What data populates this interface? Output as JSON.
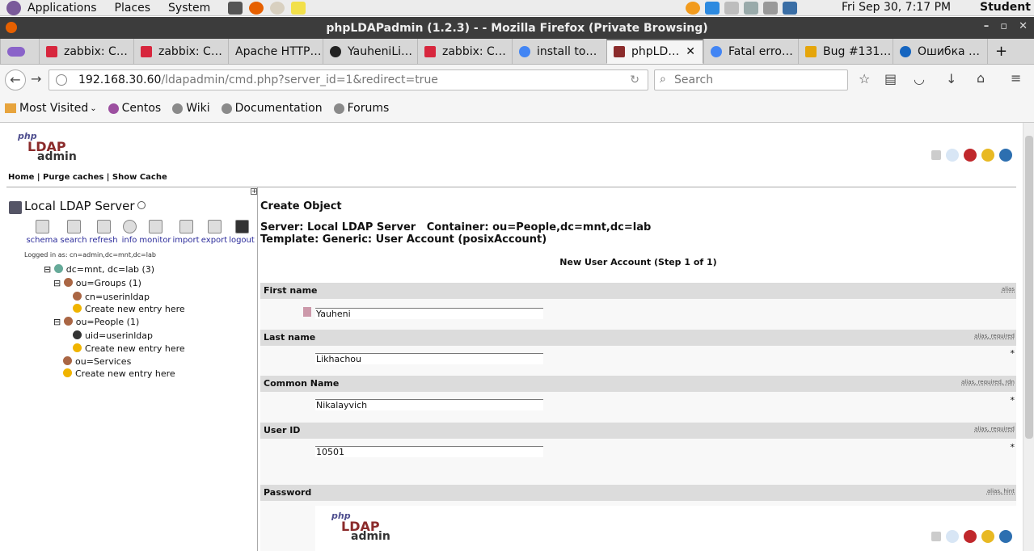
{
  "topbar": {
    "applications": "Applications",
    "places": "Places",
    "system": "System",
    "clock": "Fri Sep 30,  7:17 PM",
    "user": "Student"
  },
  "window": {
    "title": "phpLDAPadmin (1.2.3) - - Mozilla Firefox (Private Browsing)",
    "minimize": "–",
    "maximize": "▫",
    "close": "✕"
  },
  "tabs": [
    {
      "label": "zabbix: C…",
      "color": "#d7263d"
    },
    {
      "label": "zabbix: C…",
      "color": "#d7263d"
    },
    {
      "label": "Apache HTTP…",
      "color": "#d7d7d7"
    },
    {
      "label": "YauheniLi…",
      "color": "#222222"
    },
    {
      "label": "zabbix: C…",
      "color": "#d7263d"
    },
    {
      "label": "install to…",
      "color": "#4285f4"
    },
    {
      "label": "phpLD…",
      "color": "#8b2b2b"
    },
    {
      "label": "Fatal erro…",
      "color": "#4285f4"
    },
    {
      "label": "Bug #131…",
      "color": "#e5a50a"
    },
    {
      "label": "Ошибка …",
      "color": "#1565c0"
    }
  ],
  "active_tab_close": "✕",
  "new_tab": "+",
  "nav": {
    "url_host": "192.168.30.60",
    "url_path": "/ldapadmin/cmd.php?server_id=1&redirect=true",
    "search_placeholder": "Search"
  },
  "bookmarks": [
    {
      "label": "Most Visited"
    },
    {
      "label": "Centos"
    },
    {
      "label": "Wiki"
    },
    {
      "label": "Documentation"
    },
    {
      "label": "Forums"
    }
  ],
  "page": {
    "logo": {
      "php": "php",
      "ldap": "LDAP",
      "admin": "admin"
    },
    "home_links": "Home | Purge caches | Show Cache",
    "server_title": "Local LDAP Server",
    "tools": [
      {
        "label": "schema"
      },
      {
        "label": "search"
      },
      {
        "label": "refresh"
      },
      {
        "label": "info"
      },
      {
        "label": "monitor"
      },
      {
        "label": "import"
      },
      {
        "label": "export"
      },
      {
        "label": "logout"
      }
    ],
    "logged_in": "Logged in as: cn=admin,dc=mnt,dc=lab",
    "tree": {
      "root": "dc=mnt, dc=lab (3)",
      "groups": "ou=Groups (1)",
      "groups_child": "cn=userinldap",
      "groups_create": "Create new entry here",
      "people": "ou=People (1)",
      "people_child": "uid=userinldap",
      "people_create": "Create new entry here",
      "services": "ou=Services",
      "root_create": "Create new entry here"
    },
    "create_title": "Create Object",
    "server_line": "Server: Local LDAP Server   Container: ou=People,dc=mnt,dc=lab",
    "template_line": "Template: Generic: User Account (posixAccount)",
    "step_title": "New User Account (Step 1 of 1)",
    "fields": {
      "first_name": {
        "label": "First name",
        "hint": "alias",
        "value": "Yauheni"
      },
      "last_name": {
        "label": "Last name",
        "hint": "alias, required",
        "value": "Likhachou",
        "req": "*"
      },
      "common_name": {
        "label": "Common Name",
        "hint": "alias, required, rdn",
        "value": "Nikalayvich",
        "req": "*"
      },
      "user_id": {
        "label": "User ID",
        "hint": "alias, required",
        "value": "10501",
        "req": "*"
      },
      "password": {
        "label": "Password",
        "hint": "alias, hint"
      }
    }
  }
}
